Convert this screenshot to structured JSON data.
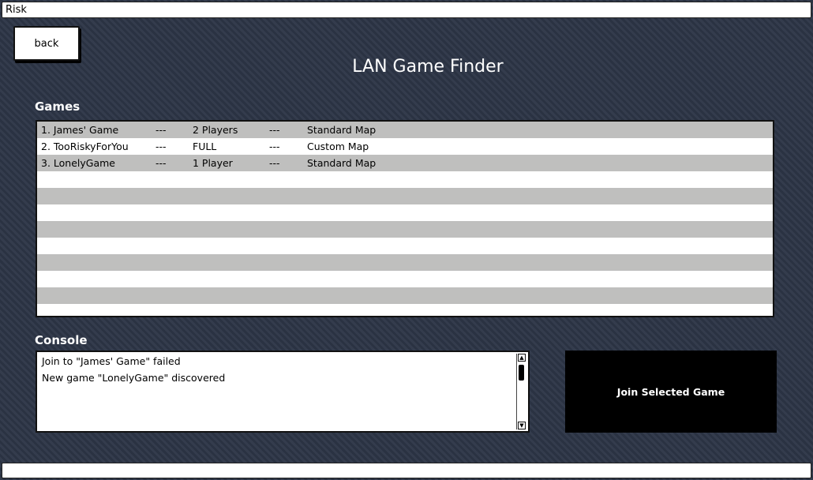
{
  "window": {
    "title": "Risk"
  },
  "toolbar": {
    "back_label": "back"
  },
  "page": {
    "title": "LAN Game Finder"
  },
  "games": {
    "label": "Games",
    "rows": [
      {
        "name": "1. James' Game",
        "sep1": "---",
        "players": "2 Players",
        "sep2": "---",
        "map": "Standard Map"
      },
      {
        "name": "2. TooRiskyForYou",
        "sep1": "---",
        "players": "FULL",
        "sep2": "---",
        "map": "Custom Map"
      },
      {
        "name": "3. LonelyGame",
        "sep1": "---",
        "players": "1 Player",
        "sep2": "---",
        "map": "Standard Map"
      }
    ]
  },
  "console": {
    "label": "Console",
    "lines": [
      "Join to \"James' Game\" failed",
      "New game \"LonelyGame\" discovered"
    ],
    "scroll_up_icon": "up-arrow-icon",
    "scroll_down_icon": "down-arrow-icon"
  },
  "actions": {
    "join_label": "Join Selected Game"
  },
  "status_bar": {
    "text": ""
  }
}
